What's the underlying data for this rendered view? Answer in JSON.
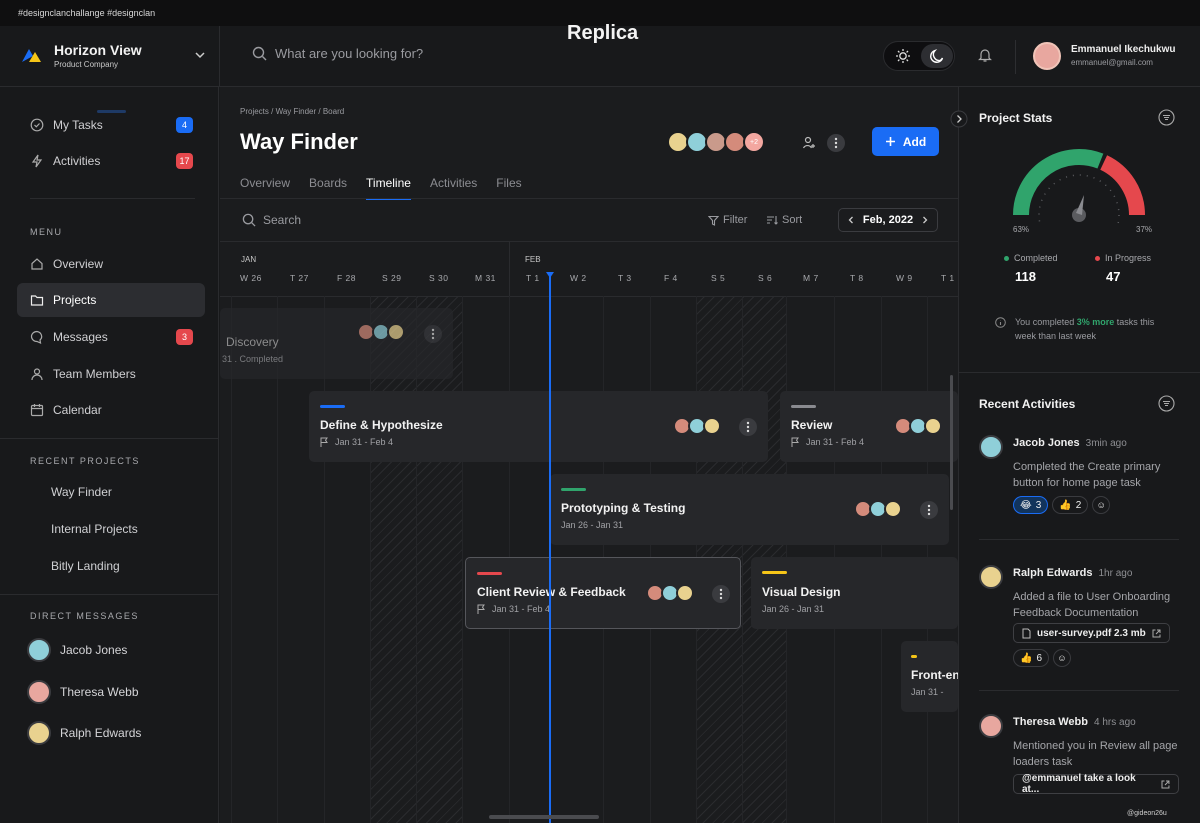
{
  "overlay": {
    "hashtags": "#designclanchallange  #designclan",
    "replica": "Replica",
    "watermark": "@gideon26u"
  },
  "brand": {
    "name": "Horizon View",
    "subtitle": "Product Company"
  },
  "search": {
    "placeholder": "What are you looking for?"
  },
  "user": {
    "name": "Emmanuel Ikechukwu",
    "email": "emmanuel@gmail.com"
  },
  "sidebar": {
    "quick": [
      {
        "label": "My Tasks",
        "badge": "4",
        "badge_color": "#1a6cf5"
      },
      {
        "label": "Activities",
        "badge": "17",
        "badge_color": "#e5484d"
      }
    ],
    "menu_title": "MENU",
    "menu": [
      {
        "label": "Overview"
      },
      {
        "label": "Projects"
      },
      {
        "label": "Messages",
        "badge": "3"
      },
      {
        "label": "Team Members"
      },
      {
        "label": "Calendar"
      }
    ],
    "recent_title": "RECENT  PROJECTS",
    "recent": [
      "Way Finder",
      "Internal Projects",
      "Bitly Landing"
    ],
    "dm_title": "DIRECT MESSAGES",
    "dms": [
      "Jacob Jones",
      "Theresa Webb",
      "Ralph Edwards"
    ]
  },
  "main": {
    "breadcrumb": "Projects  /  Way Finder  /  Board",
    "title": "Way Finder",
    "members_extra": "+2",
    "add_label": "Add",
    "tabs": [
      "Overview",
      "Boards",
      "Timeline",
      "Activities",
      "Files"
    ],
    "toolbar": {
      "search": "Search",
      "filter": "Filter",
      "sort": "Sort",
      "date": "Feb, 2022"
    }
  },
  "timeline": {
    "months": [
      "JAN",
      "FEB"
    ],
    "days": [
      "W 26",
      "T 27",
      "F 28",
      "S 29",
      "S 30",
      "M 31",
      "T 1",
      "W 2",
      "T 3",
      "F 4",
      "S 5",
      "S 6",
      "M 7",
      "T 8",
      "W 9",
      "T 1"
    ],
    "tasks": [
      {
        "title": "Discovery",
        "sub": "31  .  Completed"
      },
      {
        "title": "Define & Hypothesize",
        "sub": "Jan 31 -  Feb 4",
        "color": "#1a6cf5"
      },
      {
        "title": "Review",
        "sub": "Jan 31 -  Feb 4",
        "color": "#8a8b90"
      },
      {
        "title": "Prototyping & Testing",
        "sub": "Jan 26 -  Jan 31",
        "color": "#30a46c"
      },
      {
        "title": "Client Review & Feedback",
        "sub": "Jan 31 -  Feb 4",
        "color": "#e5484d"
      },
      {
        "title": "Visual Design",
        "sub": "Jan 26 -  Jan 31",
        "color": "#f5c518"
      },
      {
        "title": "Front-en",
        "sub": "Jan 31 -",
        "color": "#f5c518"
      }
    ]
  },
  "stats": {
    "title": "Project Stats",
    "gauge": {
      "left_pct": "63%",
      "right_pct": "37%",
      "completed_value": 0.63
    },
    "completed_label": "Completed",
    "completed": "118",
    "progress_label": "In Progress",
    "progress": "47",
    "note_pre": "You completed ",
    "note_highlight": "3% more",
    "note_post": " tasks this week than last week",
    "colors": {
      "completed": "#30a46c",
      "progress": "#e5484d"
    }
  },
  "activities": {
    "title": "Recent Activities",
    "items": [
      {
        "name": "Jacob Jones",
        "time": "3min ago",
        "text": "Completed the Create primary button for home page task",
        "r1": "3",
        "r2": "2"
      },
      {
        "name": "Ralph Edwards",
        "time": "1hr ago",
        "text": "Added a file to User Onboarding Feedback Documentation",
        "file": "user-survey.pdf 2.3 mb",
        "r1": "6"
      },
      {
        "name": "Theresa Webb",
        "time": "4 hrs ago",
        "text": "Mentioned you in Review all page loaders task",
        "file": "@emmanuel take a look at..."
      }
    ]
  }
}
